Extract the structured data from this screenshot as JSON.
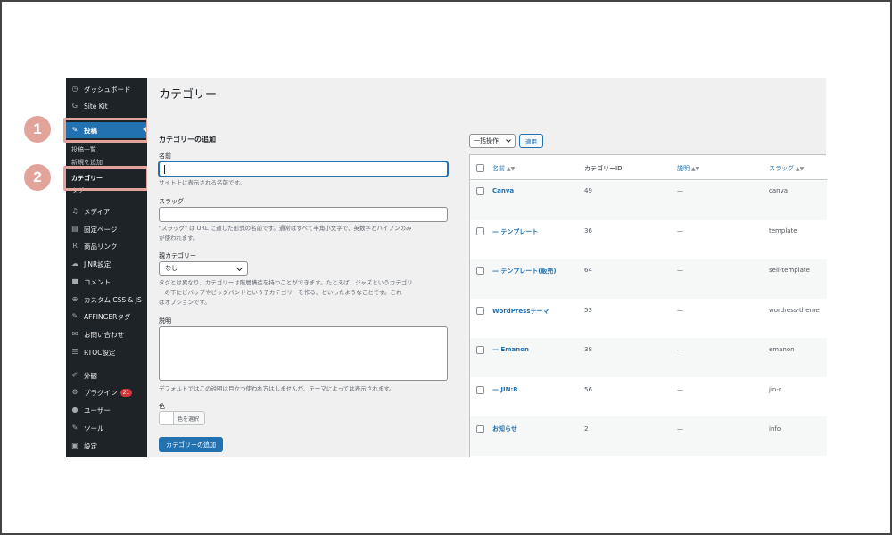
{
  "sidebar": {
    "items": [
      {
        "label": "ダッシュボード",
        "icon": "dashboard-icon",
        "glyph": "◷"
      },
      {
        "label": "Site Kit",
        "icon": "google-icon",
        "glyph": "G"
      },
      {
        "label": "投稿",
        "icon": "pin-icon",
        "glyph": "✎"
      },
      {
        "label": "メディア",
        "icon": "media-icon",
        "glyph": "♫"
      },
      {
        "label": "固定ページ",
        "icon": "page-icon",
        "glyph": "▤"
      },
      {
        "label": "商品リンク",
        "icon": "product-link-icon",
        "glyph": "R"
      },
      {
        "label": "JINR設定",
        "icon": "settings-cloud-icon",
        "glyph": "☁"
      },
      {
        "label": "コメント",
        "icon": "comment-icon",
        "glyph": "■"
      },
      {
        "label": "カスタム CSS & JS",
        "icon": "plus-circle-icon",
        "glyph": "⊕"
      },
      {
        "label": "AFFINGERタグ",
        "icon": "tag-pin-icon",
        "glyph": "✎"
      },
      {
        "label": "お問い合わせ",
        "icon": "mail-icon",
        "glyph": "✉"
      },
      {
        "label": "RTOC設定",
        "icon": "list-icon",
        "glyph": "☰"
      },
      {
        "label": "外観",
        "icon": "brush-icon",
        "glyph": "✐"
      },
      {
        "label": "プラグイン",
        "icon": "plugin-icon",
        "glyph": "⚙",
        "badge": "21"
      },
      {
        "label": "ユーザー",
        "icon": "user-icon",
        "glyph": "●"
      },
      {
        "label": "ツール",
        "icon": "wrench-icon",
        "glyph": "✎"
      },
      {
        "label": "設定",
        "icon": "settings-icon",
        "glyph": "▣"
      }
    ],
    "sub_items": [
      "投稿一覧",
      "新規を追加",
      "カテゴリー",
      "タグ"
    ]
  },
  "annotations": {
    "step1": "1",
    "step2": "2",
    "accent": "#e2a39a"
  },
  "page": {
    "title": "カテゴリー"
  },
  "form": {
    "section_title": "カテゴリーの追加",
    "name_label": "名前",
    "name_value": "",
    "name_help": "サイト上に表示される名前です。",
    "slug_label": "スラッグ",
    "slug_value": "",
    "slug_help_line1": "\"スラッグ\" は URL に適した形式の名前です。通常はすべて半角小文字で、英数字とハイフンのみ",
    "slug_help_line2": "が使われます。",
    "parent_label": "親カテゴリー",
    "parent_value": "なし",
    "parent_help_line1": "タグとは異なり、カテゴリーは階層構造を持つことができます。たとえば、ジャズというカテゴリ",
    "parent_help_line2": "ーの下にビバップやビッグバンドという子カテゴリーを作る、といったようなことです。これ",
    "parent_help_line3": "はオプションです。",
    "desc_label": "説明",
    "desc_value": "",
    "desc_help": "デフォルトではこの説明は目立つ使われ方はしませんが、テーマによっては表示されます。",
    "color_label": "色",
    "color_button": "色を選択",
    "submit": "カテゴリーの追加"
  },
  "table": {
    "bulk_action": "一括操作",
    "apply": "適用",
    "headers": {
      "name": "名前",
      "id": "カテゴリーID",
      "desc": "説明",
      "slug": "スラッグ"
    },
    "rows": [
      {
        "name": "Canva",
        "id": "49",
        "desc": "—",
        "slug": "canva"
      },
      {
        "name": "— テンプレート",
        "id": "36",
        "desc": "—",
        "slug": "template"
      },
      {
        "name": "— テンプレート(販売)",
        "id": "64",
        "desc": "—",
        "slug": "sell-template"
      },
      {
        "name": "WordPressテーマ",
        "id": "53",
        "desc": "—",
        "slug": "wordress-theme"
      },
      {
        "name": "— Emanon",
        "id": "38",
        "desc": "—",
        "slug": "emanon"
      },
      {
        "name": "— JIN:R",
        "id": "56",
        "desc": "—",
        "slug": "jin-r"
      },
      {
        "name": "お知らせ",
        "id": "2",
        "desc": "—",
        "slug": "info"
      }
    ]
  },
  "colors": {
    "sidebar_bg": "#1d2327",
    "active": "#2271b1",
    "link": "#2271b1"
  }
}
